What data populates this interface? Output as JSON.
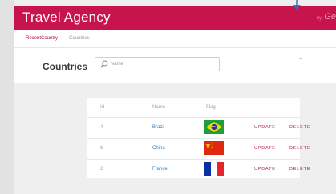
{
  "app": {
    "title": "Travel Agency",
    "byline_small": "by",
    "byline_brand": "Ge"
  },
  "breadcrumb": {
    "recent": "RecentCountry",
    "separator": "—",
    "current": "Countries"
  },
  "page": {
    "title": "Countries"
  },
  "search": {
    "placeholder": "Name",
    "value": ""
  },
  "table": {
    "headers": {
      "id": "Id",
      "name": "Name",
      "flag": "Flag"
    },
    "update_label": "UPDATE",
    "delete_label": "DELETE",
    "rows": [
      {
        "id": "4",
        "name": "Brazil",
        "flag": "brazil-flag-icon"
      },
      {
        "id": "6",
        "name": "China",
        "flag": "china-flag-icon"
      },
      {
        "id": "2",
        "name": "France",
        "flag": "france-flag-icon"
      }
    ]
  },
  "colors": {
    "header_bg": "#c8144c",
    "accent": "#b51d4e",
    "link": "#2b7cc9",
    "background": "#efefef"
  }
}
